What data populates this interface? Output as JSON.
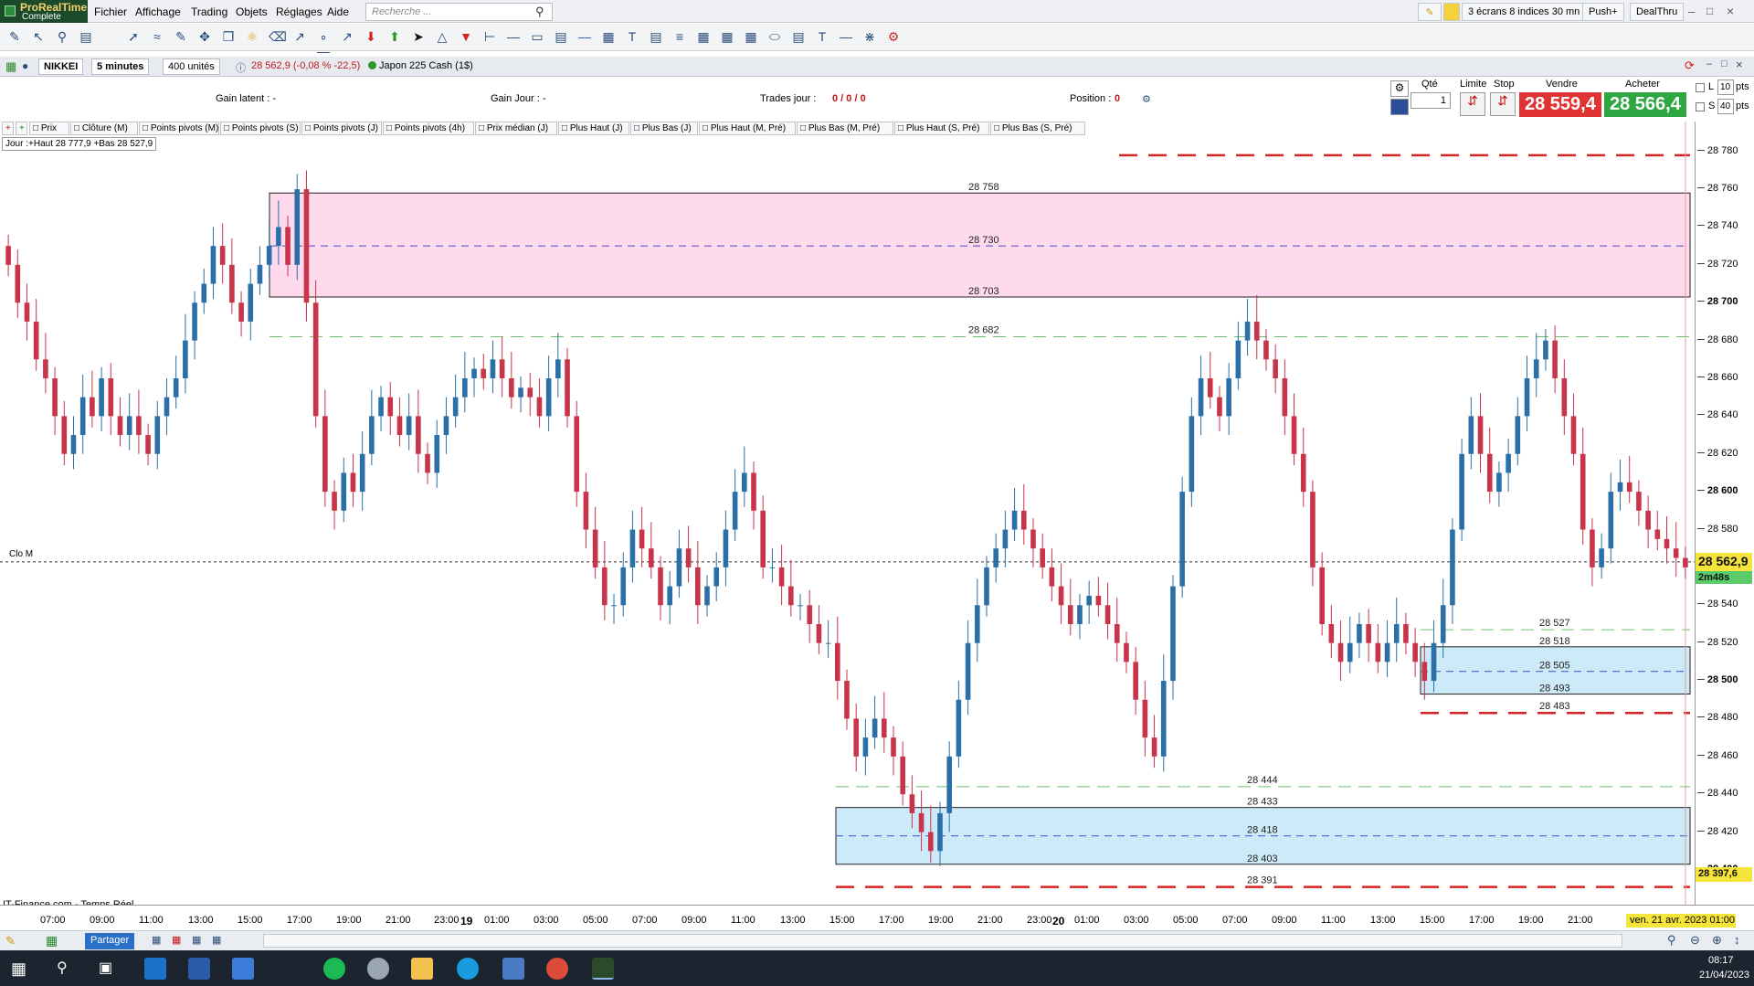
{
  "app": {
    "brand": "ProRealTime",
    "edition": "Complete"
  },
  "menu": [
    "Fichier",
    "Affichage",
    "Trading",
    "Objets",
    "Réglages",
    "Aide"
  ],
  "search": {
    "placeholder": "Recherche ..."
  },
  "top_right": {
    "layout": "3 écrans 8 indices 30 mn",
    "push": "Push+",
    "broker": "DealThru"
  },
  "instrument": {
    "symbol": "NIKKEI",
    "timeframe": "5 minutes",
    "units": "400 unités",
    "quote": "28 562,9 (-0,08 % -22,5)",
    "name": "Japon 225 Cash (1$)"
  },
  "info": {
    "gain_latent": "Gain latent : -",
    "gain_jour": "Gain Jour : -",
    "trades_label": "Trades jour : ",
    "trades_value": "0 / 0 / 0",
    "position_label": "Position : ",
    "position_value": "0"
  },
  "ticket": {
    "qty_label": "Qté",
    "qty": "1",
    "limit_label": "Limite",
    "stop_label": "Stop",
    "sell_label": "Vendre",
    "sell_price": "28 559,4",
    "buy_label": "Acheter",
    "buy_price": "28 566,4",
    "l_label": "L",
    "l_value": "10",
    "s_label": "S",
    "s_value": "40",
    "pts": "pts"
  },
  "legend": [
    "Prix",
    "Clôture (M)",
    "Points pivots (M)",
    "Points pivots (S)",
    "Points pivots (J)",
    "Points pivots (4h)",
    "Prix médian (J)",
    "Plus Haut (J)",
    "Plus Bas (J)",
    "Plus Haut (M, Pré)",
    "Plus Bas (M, Pré)",
    "Plus Haut (S, Pré)",
    "Plus Bas (S, Pré)"
  ],
  "day_box": "Jour :+Haut 28 777,9 +Bas 28 527,9",
  "clo_label": "Clo M",
  "source": "IT-Finance.com - Temps Réel",
  "chart_data": {
    "type": "candlestick",
    "y_range": [
      28385,
      28790
    ],
    "y_ticks": [
      "28 780",
      "28 760",
      "28 740",
      "28 720",
      "28 700",
      "28 680",
      "28 660",
      "28 640",
      "28 620",
      "28 600",
      "28 580",
      "28 560",
      "28 540",
      "28 520",
      "28 500",
      "28 480",
      "28 460",
      "28 440",
      "28 420",
      "28 400"
    ],
    "x_ticks": [
      "07:00",
      "09:00",
      "11:00",
      "13:00",
      "15:00",
      "17:00",
      "19:00",
      "21:00",
      "23:00",
      "19",
      "01:00",
      "03:00",
      "05:00",
      "07:00",
      "09:00",
      "11:00",
      "13:00",
      "15:00",
      "17:00",
      "19:00",
      "21:00",
      "23:00",
      "20",
      "01:00",
      "03:00",
      "05:00",
      "07:00",
      "09:00",
      "11:00",
      "13:00",
      "15:00",
      "17:00",
      "19:00",
      "21:00"
    ],
    "zones": [
      {
        "top": 28758,
        "mid": 28730,
        "bottom": 28703,
        "color": "#ffd9ec",
        "labels": [
          "28 758",
          "28 730",
          "28 703"
        ]
      },
      {
        "top": 28518,
        "mid": 28505,
        "bottom": 28493,
        "color": "#cdeaf8",
        "labels": [
          "28 518",
          "28 505",
          "28 493"
        ]
      },
      {
        "top": 28433,
        "mid": 28418,
        "bottom": 28403,
        "color": "#cdeaf8",
        "labels": [
          "28 433",
          "28 418",
          "28 403"
        ]
      }
    ],
    "levels": [
      {
        "value": 28682,
        "label": "28 682",
        "color": "#6dbf6d"
      },
      {
        "value": 28527,
        "label": "28 527",
        "color": "#6dbf6d"
      },
      {
        "value": 28444,
        "label": "28 444",
        "color": "#6dbf6d"
      },
      {
        "value": 28483,
        "label": "28 483",
        "color": "#d42424"
      },
      {
        "value": 28391,
        "label": "28 391",
        "color": "#d42424"
      },
      {
        "value": 28778,
        "label": "",
        "color": "#d42424"
      }
    ],
    "last_price": "28 562,9",
    "countdown": "2m48s",
    "low_marker": "28 397,6",
    "cursor_date": "ven. 21 avr. 2023 01:00",
    "closes": [
      28720,
      28700,
      28690,
      28670,
      28660,
      28640,
      28620,
      28630,
      28650,
      28640,
      28660,
      28640,
      28630,
      28640,
      28630,
      28620,
      28640,
      28650,
      28660,
      28680,
      28700,
      28710,
      28730,
      28720,
      28700,
      28690,
      28710,
      28720,
      28730,
      28740,
      28720,
      28760,
      28700,
      28640,
      28600,
      28590,
      28610,
      28600,
      28620,
      28640,
      28650,
      28640,
      28630,
      28640,
      28620,
      28610,
      28630,
      28640,
      28650,
      28660,
      28665,
      28660,
      28670,
      28660,
      28650,
      28655,
      28650,
      28640,
      28660,
      28670,
      28640,
      28600,
      28580,
      28560,
      28540,
      28540,
      28560,
      28580,
      28570,
      28560,
      28540,
      28550,
      28570,
      28560,
      28540,
      28550,
      28560,
      28580,
      28600,
      28610,
      28590,
      28560,
      28560,
      28550,
      28540,
      28540,
      28530,
      28520,
      28520,
      28500,
      28480,
      28460,
      28470,
      28480,
      28470,
      28460,
      28440,
      28430,
      28420,
      28410,
      28430,
      28460,
      28490,
      28520,
      28540,
      28560,
      28570,
      28580,
      28590,
      28580,
      28570,
      28560,
      28550,
      28540,
      28530,
      28540,
      28545,
      28540,
      28530,
      28520,
      28510,
      28490,
      28470,
      28460,
      28500,
      28550,
      28600,
      28640,
      28660,
      28650,
      28640,
      28660,
      28680,
      28690,
      28680,
      28670,
      28660,
      28640,
      28620,
      28600,
      28560,
      28530,
      28520,
      28510,
      28520,
      28530,
      28520,
      28510,
      28520,
      28530,
      28520,
      28510,
      28500,
      28520,
      28540,
      28580,
      28620,
      28640,
      28620,
      28600,
      28610,
      28620,
      28640,
      28660,
      28670,
      28680,
      28660,
      28640,
      28620,
      28580,
      28560,
      28570,
      28600,
      28605,
      28600,
      28590,
      28580,
      28575,
      28570,
      28565,
      28560
    ]
  },
  "footer": {
    "share": "Partager"
  },
  "clock": {
    "time": "08:17",
    "date": "21/04/2023"
  }
}
